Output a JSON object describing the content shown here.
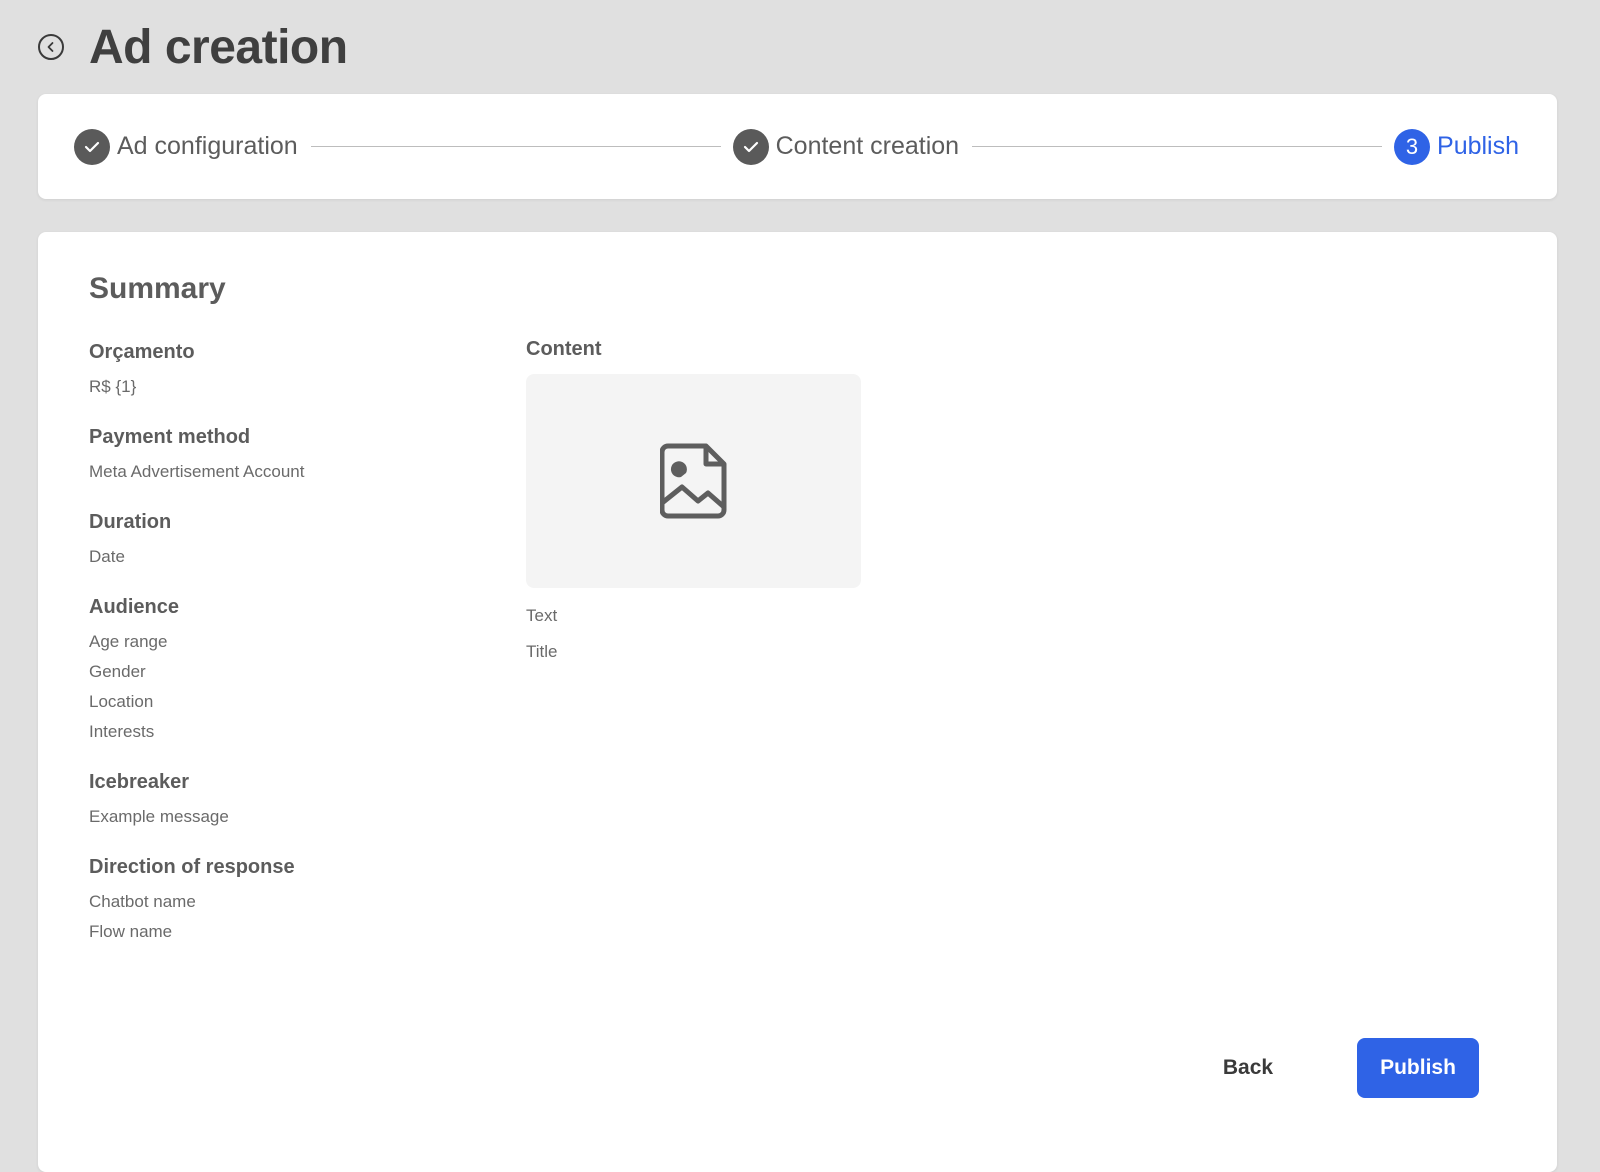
{
  "header": {
    "title": "Ad creation",
    "back_icon": "chevron-left-circle-icon"
  },
  "stepper": {
    "steps": [
      {
        "label": "Ad configuration",
        "status": "completed",
        "icon": "check-icon"
      },
      {
        "label": "Content creation",
        "status": "completed",
        "icon": "check-icon"
      },
      {
        "label": "Publish",
        "status": "active",
        "number": "3"
      }
    ],
    "active_color": "#2f63e6",
    "completed_color": "#5a5a5a"
  },
  "summary": {
    "title": "Summary",
    "fields": [
      {
        "heading": "Orçamento",
        "values": [
          "R$ {1}"
        ]
      },
      {
        "heading": "Payment method",
        "values": [
          "Meta Advertisement Account"
        ]
      },
      {
        "heading": "Duration",
        "values": [
          "Date"
        ]
      },
      {
        "heading": "Audience",
        "values": [
          "Age range",
          "Gender",
          "Location",
          "Interests"
        ]
      },
      {
        "heading": "Icebreaker",
        "values": [
          "Example message"
        ]
      },
      {
        "heading": "Direction of response",
        "values": [
          "Chatbot name",
          "Flow name"
        ]
      }
    ],
    "content": {
      "heading": "Content",
      "image_icon": "image-placeholder-icon",
      "text_label": "Text",
      "title_label": "Title"
    }
  },
  "actions": {
    "back_label": "Back",
    "publish_label": "Publish",
    "publish_color": "#2f63e6"
  }
}
